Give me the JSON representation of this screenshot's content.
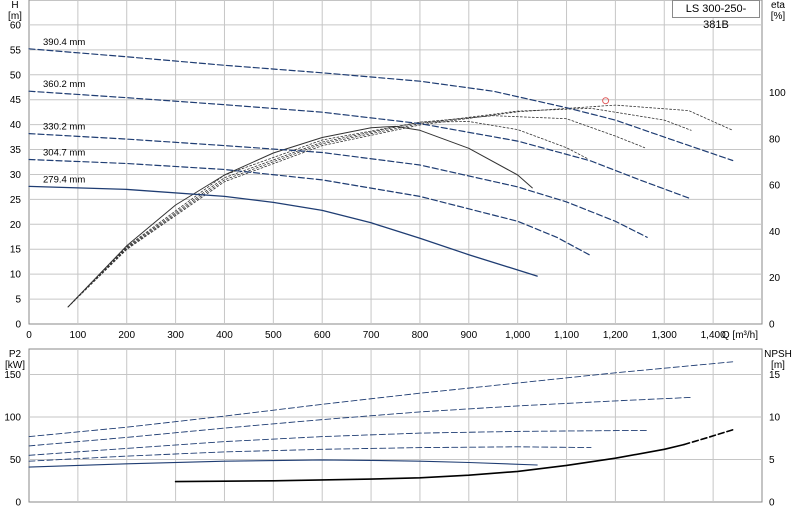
{
  "model_label": "LS 300-250-381B",
  "chart_data": [
    {
      "type": "line",
      "title": "",
      "y_left_label": [
        "H",
        "[m]"
      ],
      "y_right_label": [
        "eta",
        "[%]"
      ],
      "x_label": "Q [m³/h]",
      "grid": true,
      "xlim": [
        0,
        1500
      ],
      "ylim": [
        0,
        65
      ],
      "y_right_lim": [
        0,
        140
      ],
      "x_ticks": [
        0,
        100,
        200,
        300,
        400,
        500,
        600,
        700,
        800,
        900,
        1000,
        1100,
        1200,
        1300,
        1400
      ],
      "x_tick_labels": [
        "0",
        "100",
        "200",
        "300",
        "400",
        "500",
        "600",
        "700",
        "800",
        "900",
        "1,000",
        "1,100",
        "1,200",
        "1,300",
        "1,400"
      ],
      "y_ticks": [
        0,
        5,
        10,
        15,
        20,
        25,
        30,
        35,
        40,
        45,
        50,
        55,
        60
      ],
      "y_tick_labels": [
        "0",
        "5",
        "10",
        "15",
        "20",
        "25",
        "30",
        "35",
        "40",
        "45",
        "50",
        "55",
        "60"
      ],
      "y_right_ticks": [
        0,
        20,
        40,
        60,
        80,
        100
      ],
      "y_right_tick_labels": [
        "0",
        "20",
        "40",
        "60",
        "80",
        "100"
      ],
      "head_series": [
        {
          "name": "390.4 mm",
          "style": "dashed",
          "x": [
            0,
            200,
            400,
            600,
            800,
            950,
            1100,
            1200,
            1300,
            1440
          ],
          "y": [
            55.2,
            53.6,
            51.9,
            50.4,
            48.7,
            46.7,
            43.4,
            40.9,
            37.5,
            32.8
          ]
        },
        {
          "name": "360.2 mm",
          "style": "dashed",
          "x": [
            0,
            200,
            400,
            600,
            800,
            1000,
            1150,
            1250,
            1355
          ],
          "y": [
            46.7,
            45.4,
            44.0,
            42.5,
            40.2,
            36.7,
            32.7,
            28.9,
            25.1
          ]
        },
        {
          "name": "330.2 mm",
          "style": "dashed",
          "x": [
            0,
            200,
            400,
            600,
            800,
            1000,
            1100,
            1200,
            1265
          ],
          "y": [
            38.2,
            37.1,
            35.8,
            34.4,
            31.9,
            27.5,
            24.5,
            20.6,
            17.4
          ]
        },
        {
          "name": "304.7 mm",
          "style": "dashed",
          "x": [
            0,
            200,
            400,
            600,
            800,
            1000,
            1080,
            1150
          ],
          "y": [
            33.0,
            32.2,
            31.0,
            28.9,
            25.6,
            20.6,
            17.4,
            13.7
          ]
        },
        {
          "name": "279.4 mm",
          "style": "solid",
          "x": [
            0,
            200,
            400,
            500,
            600,
            700,
            800,
            900,
            1040
          ],
          "y": [
            27.6,
            27.0,
            25.6,
            24.4,
            22.8,
            20.3,
            17.2,
            13.9,
            9.6
          ]
        }
      ],
      "eta_series": [
        {
          "name": "",
          "style": "solid",
          "x": [
            80,
            200,
            300,
            400,
            500,
            600,
            700,
            750,
            800,
            900,
            1000,
            1030
          ],
          "y": [
            7.4,
            33.8,
            51.4,
            64.4,
            73.9,
            80.6,
            84.8,
            85.4,
            83.7,
            75.9,
            64.4,
            58.8
          ]
        },
        {
          "name": "",
          "style": "dotted",
          "x": [
            80,
            200,
            400,
            600,
            800,
            900,
            1000,
            1100,
            1145
          ],
          "y": [
            7.4,
            33.4,
            64.4,
            79.5,
            87.2,
            87.5,
            84.0,
            76.2,
            71.2
          ]
        },
        {
          "name": "",
          "style": "dotted",
          "x": [
            80,
            200,
            400,
            600,
            800,
            950,
            1100,
            1200,
            1260
          ],
          "y": [
            7.4,
            33.0,
            63.2,
            78.6,
            87.2,
            90.0,
            88.7,
            81.2,
            76.2
          ]
        },
        {
          "name": "",
          "style": "dotted",
          "x": [
            80,
            200,
            400,
            600,
            800,
            1000,
            1150,
            1300,
            1355
          ],
          "y": [
            7.4,
            32.6,
            62.3,
            77.9,
            86.6,
            92.0,
            93.2,
            88.1,
            83.7
          ]
        },
        {
          "name": "",
          "style": "dotted",
          "x": [
            80,
            200,
            400,
            600,
            800,
            1000,
            1200,
            1350,
            1440
          ],
          "y": [
            7.4,
            32.2,
            61.5,
            77.1,
            86.0,
            91.7,
            94.6,
            92.2,
            83.7
          ]
        }
      ],
      "marker": {
        "x": 1180,
        "y": 44.8,
        "shape": "circle",
        "color": "#e05a5a"
      },
      "line_color": "#1f3d73",
      "eta_color": "#333333"
    },
    {
      "type": "line",
      "title": "",
      "y_left_label": [
        "P2",
        "[kW]"
      ],
      "y_right_label": [
        "NPSH",
        "[m]"
      ],
      "grid": true,
      "xlim": [
        0,
        1500
      ],
      "ylim": [
        0,
        180
      ],
      "y_right_lim": [
        0,
        18
      ],
      "x_ticks": [
        0,
        100,
        200,
        300,
        400,
        500,
        600,
        700,
        800,
        900,
        1000,
        1100,
        1200,
        1300,
        1400
      ],
      "y_ticks": [
        0,
        50,
        100,
        150
      ],
      "y_tick_labels": [
        "0",
        "50",
        "100",
        "150"
      ],
      "y_right_ticks": [
        0,
        5,
        10,
        15
      ],
      "y_right_tick_labels": [
        "0",
        "5",
        "10",
        "15"
      ],
      "power_series": [
        {
          "name": "",
          "style": "dashed",
          "x": [
            0,
            200,
            400,
            600,
            800,
            1000,
            1200,
            1440
          ],
          "y": [
            77,
            88,
            101,
            115,
            128,
            140,
            152,
            165
          ]
        },
        {
          "name": "",
          "style": "dashed",
          "x": [
            0,
            200,
            400,
            600,
            800,
            1000,
            1200,
            1355
          ],
          "y": [
            66,
            76,
            87,
            97,
            106,
            113,
            119,
            123
          ]
        },
        {
          "name": "",
          "style": "dashed",
          "x": [
            0,
            200,
            400,
            600,
            800,
            1000,
            1200,
            1265
          ],
          "y": [
            55,
            63,
            71,
            77,
            81,
            83,
            84,
            84
          ]
        },
        {
          "name": "",
          "style": "dashed",
          "x": [
            0,
            200,
            400,
            600,
            800,
            1000,
            1150
          ],
          "y": [
            48,
            54,
            59,
            62,
            64,
            65,
            64
          ]
        },
        {
          "name": "",
          "style": "solid",
          "x": [
            0,
            200,
            400,
            600,
            700,
            800,
            900,
            1040
          ],
          "y": [
            41,
            45,
            48,
            49.5,
            49,
            48,
            46.5,
            43.5
          ]
        }
      ],
      "npsh_series": [
        {
          "name": "",
          "style": "solid",
          "x": [
            300,
            400,
            500,
            600,
            700,
            800,
            900,
            1000,
            1100,
            1200,
            1300,
            1340
          ],
          "y": [
            2.4,
            2.45,
            2.5,
            2.6,
            2.7,
            2.85,
            3.15,
            3.6,
            4.3,
            5.15,
            6.2,
            6.75
          ]
        },
        {
          "name": "",
          "style": "dashed",
          "x": [
            1340,
            1390,
            1440
          ],
          "y": [
            6.75,
            7.6,
            8.5
          ]
        }
      ],
      "line_color": "#1f3d73",
      "npsh_color": "#000000"
    }
  ]
}
